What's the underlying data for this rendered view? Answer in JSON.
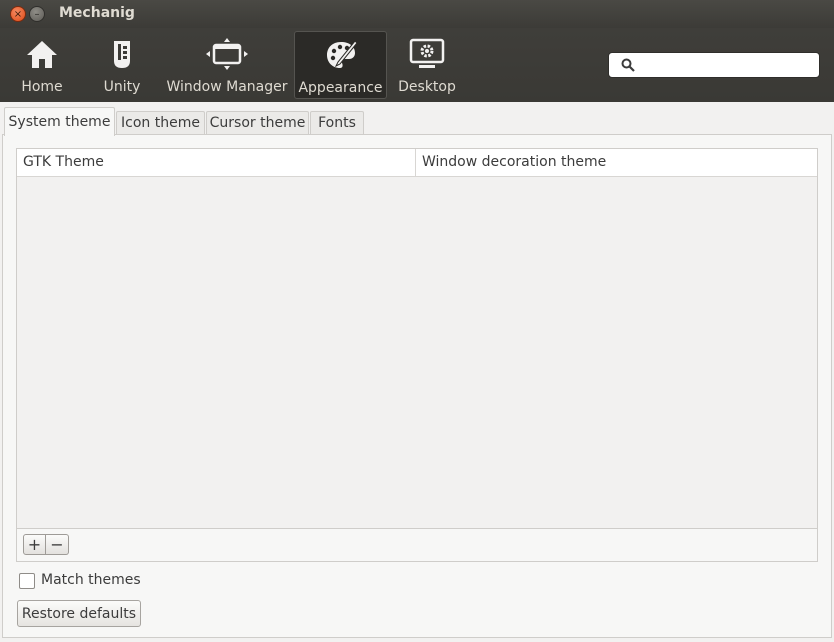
{
  "window": {
    "title": "Mechanig",
    "close_glyph": "×",
    "minimize_glyph": "–"
  },
  "toolbar": {
    "items": [
      {
        "label": "Home",
        "icon": "home-icon"
      },
      {
        "label": "Unity",
        "icon": "unity-icon"
      },
      {
        "label": "Window Manager",
        "icon": "window-manager-icon"
      },
      {
        "label": "Appearance",
        "icon": "palette-icon",
        "active": true
      },
      {
        "label": "Desktop",
        "icon": "desktop-icon"
      }
    ],
    "search": {
      "placeholder": "",
      "value": ""
    }
  },
  "tabs": [
    {
      "label": "System theme",
      "active": true
    },
    {
      "label": "Icon theme"
    },
    {
      "label": "Cursor theme"
    },
    {
      "label": "Fonts"
    }
  ],
  "table": {
    "columns": [
      "GTK Theme",
      "Window decoration theme"
    ],
    "rows": []
  },
  "list_toolbar": {
    "add_label": "+",
    "remove_label": "−"
  },
  "match_themes": {
    "label": "Match themes",
    "checked": false
  },
  "restore_defaults": {
    "label": "Restore defaults"
  },
  "colors": {
    "titlebar": "#3c3b37",
    "toolbar": "#3c3b37",
    "close_button": "#df4a16",
    "background": "#f2f1f0"
  }
}
